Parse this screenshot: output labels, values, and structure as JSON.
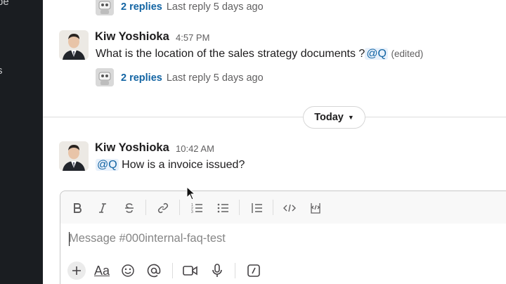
{
  "sidebar": {
    "fragments": [
      "be",
      "s"
    ]
  },
  "thread_top": {
    "replies_label": "2 replies",
    "last_reply": "Last reply 5 days ago"
  },
  "messages": [
    {
      "author": "Kiw Yoshioka",
      "time": "4:57 PM",
      "text": "What is the location of the sales strategy documents ?",
      "mention": "@Q",
      "edited": "(edited)",
      "replies_label": "2 replies",
      "last_reply": "Last reply 5 days ago"
    },
    {
      "author": "Kiw Yoshioka",
      "time": "10:42 AM",
      "mention": "@Q",
      "text": "How is a invoice issued?"
    }
  ],
  "day_divider": {
    "label": "Today"
  },
  "composer": {
    "placeholder": "Message #000internal-faq-test",
    "format_tools": [
      "bold-icon",
      "italic-icon",
      "strikethrough-icon",
      "link-icon",
      "ordered-list-icon",
      "bulleted-list-icon",
      "blockquote-icon",
      "code-icon",
      "code-block-icon"
    ],
    "bottom_tools": [
      "plus-icon",
      "text-format-icon",
      "emoji-icon",
      "mention-icon",
      "video-icon",
      "microphone-icon",
      "slash-command-icon"
    ],
    "aa_label": "Aa"
  },
  "colors": {
    "sidebar_bg": "#1a1d21",
    "link": "#1264a3",
    "mention_bg": "#e8f1fb",
    "muted": "#616061"
  }
}
